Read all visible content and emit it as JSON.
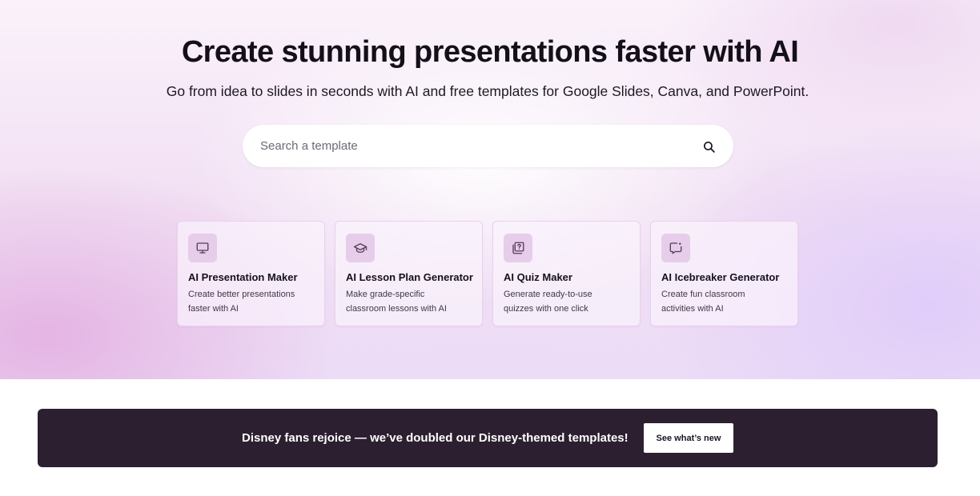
{
  "hero": {
    "title": "Create stunning presentations faster with AI",
    "subtitle": "Go from idea to slides in seconds with AI and free templates for Google Slides, Canva, and PowerPoint."
  },
  "search": {
    "placeholder": "Search a template",
    "value": "",
    "icon": "search-icon"
  },
  "tools": [
    {
      "icon": "monitor-icon",
      "title": "AI Presentation Maker",
      "line1": "Create better presentations",
      "line2": "faster with AI"
    },
    {
      "icon": "graduation-cap-icon",
      "title": "AI Lesson Plan Generator",
      "line1": "Make grade-specific",
      "line2": "classroom lessons with AI"
    },
    {
      "icon": "quiz-icon",
      "title": "AI Quiz Maker",
      "line1": "Generate ready-to-use",
      "line2": "quizzes with one click"
    },
    {
      "icon": "chat-icon",
      "title": "AI Icebreaker Generator",
      "line1": "Create fun classroom",
      "line2": "activities with AI"
    }
  ],
  "banner": {
    "text": "Disney fans rejoice — we’ve doubled our Disney-themed templates!",
    "button": "See what’s new"
  },
  "colors": {
    "banner_bg": "#2c2030",
    "icon_tile_bg": "#e6cdea",
    "card_border": "#ecd0ee",
    "icon_stroke": "#5a3b5e"
  }
}
